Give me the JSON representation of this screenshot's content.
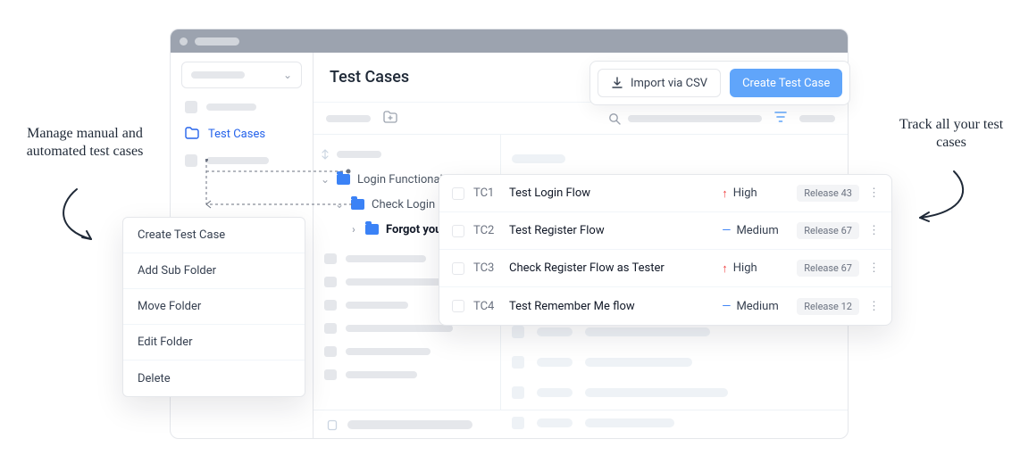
{
  "header": {
    "title": "Test Cases"
  },
  "sidebar": {
    "items": [
      {
        "label": "Test Cases"
      }
    ]
  },
  "tree": {
    "root": "Login Functionality",
    "child": "Check Login",
    "grandchild": "Forgot your l"
  },
  "actions": {
    "import": "Import via CSV",
    "create": "Create Test Case"
  },
  "tc": [
    {
      "id": "TC1",
      "name": "Test Login Flow",
      "priority": "High",
      "release": "Release 43"
    },
    {
      "id": "TC2",
      "name": "Test Register Flow",
      "priority": "Medium",
      "release": "Release 67"
    },
    {
      "id": "TC3",
      "name": "Check Register Flow as Tester",
      "priority": "High",
      "release": "Release 67"
    },
    {
      "id": "TC4",
      "name": "Test Remember Me flow",
      "priority": "Medium",
      "release": "Release 12"
    }
  ],
  "ctx": {
    "items": [
      "Create Test Case",
      "Add Sub Folder",
      "Move Folder",
      "Edit Folder",
      "Delete"
    ]
  },
  "anno": {
    "left": "Manage manual and automated test cases",
    "right": "Track all your test cases"
  }
}
